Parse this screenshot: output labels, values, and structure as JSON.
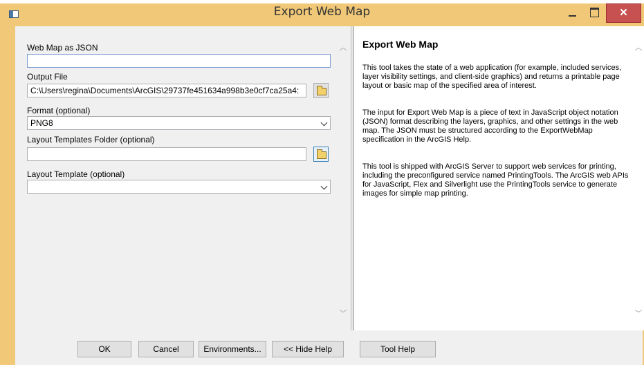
{
  "window": {
    "title": "Export Web Map"
  },
  "form": {
    "web_map_json": {
      "label": "Web Map as JSON",
      "value": ""
    },
    "output_file": {
      "label": "Output File",
      "value": "C:\\Users\\regina\\Documents\\ArcGIS\\29737fe451634a998b3e0cf7ca25a4:"
    },
    "format": {
      "label": "Format (optional)",
      "value": "PNG8"
    },
    "layout_templates_folder": {
      "label": "Layout Templates Folder (optional)",
      "value": ""
    },
    "layout_template": {
      "label": "Layout Template (optional)",
      "value": ""
    }
  },
  "help": {
    "title": "Export Web Map",
    "paragraphs": [
      "This tool takes the state of a web application (for example, included services, layer visibility settings, and client-side graphics) and returns a printable page layout or basic map of the specified area of interest.",
      "The input for Export Web Map is a piece of text in JavaScript object notation (JSON) format describing the layers, graphics, and other settings in the web map. The JSON must be structured according to the ExportWebMap specification in the ArcGIS Help.",
      "This tool is shipped with ArcGIS Server to support web services for printing, including the preconfigured service named PrintingTools. The ArcGIS web APIs for JavaScript, Flex and Silverlight use the PrintingTools service to generate images for simple map printing."
    ]
  },
  "buttons": {
    "ok": "OK",
    "cancel": "Cancel",
    "environments": "Environments...",
    "hide_help": "<< Hide Help",
    "tool_help": "Tool Help"
  },
  "titlebar_buttons": {
    "close": "✕"
  },
  "colors": {
    "titlebar": "#f0c878",
    "close": "#c75050",
    "field_border": "#7a9cd3"
  }
}
